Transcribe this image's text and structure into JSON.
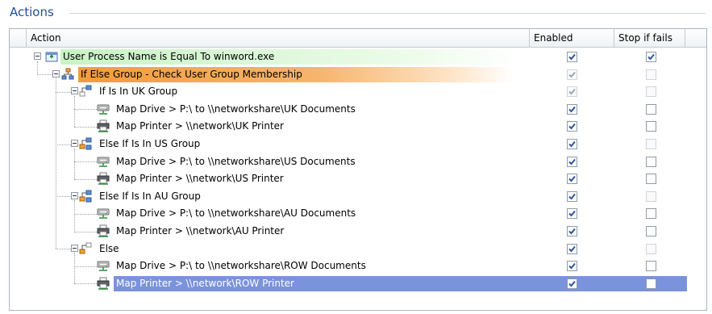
{
  "section": {
    "title": "Actions"
  },
  "columns": {
    "action": "Action",
    "enabled": "Enabled",
    "stop": "Stop if fails"
  },
  "rows": [
    {
      "label": "User Process Name is Equal To winword.exe",
      "level": 0,
      "icon": "process-condition-icon",
      "style": "green",
      "expanded": true,
      "enabled": true,
      "enabled_disabled": false,
      "stop": true,
      "stop_disabled": false
    },
    {
      "label": "If Else Group - Check User Group Membership",
      "level": 1,
      "icon": "if-else-group-icon",
      "style": "orange",
      "expanded": true,
      "enabled": true,
      "enabled_disabled": true,
      "stop": false,
      "stop_disabled": true
    },
    {
      "label": "If Is In UK Group",
      "level": 2,
      "icon": "if-branch-icon",
      "style": "",
      "expanded": true,
      "enabled": true,
      "enabled_disabled": true,
      "stop": false,
      "stop_disabled": true
    },
    {
      "label": "Map Drive > P:\\ to \\\\networkshare\\UK Documents",
      "level": 3,
      "icon": "map-drive-icon",
      "style": "",
      "enabled": true,
      "enabled_disabled": false,
      "stop": false,
      "stop_disabled": false
    },
    {
      "label": "Map Printer > \\\\network\\UK Printer",
      "level": 3,
      "icon": "printer-icon",
      "style": "",
      "enabled": true,
      "enabled_disabled": false,
      "stop": false,
      "stop_disabled": false
    },
    {
      "label": "Else If Is In US Group",
      "level": 2,
      "icon": "else-if-branch-icon",
      "style": "",
      "expanded": true,
      "enabled": true,
      "enabled_disabled": false,
      "stop": false,
      "stop_disabled": true
    },
    {
      "label": "Map Drive > P:\\ to \\\\networkshare\\US Documents",
      "level": 3,
      "icon": "map-drive-icon",
      "style": "",
      "enabled": true,
      "enabled_disabled": false,
      "stop": false,
      "stop_disabled": false
    },
    {
      "label": "Map Printer > \\\\network\\US Printer",
      "level": 3,
      "icon": "printer-icon",
      "style": "",
      "enabled": true,
      "enabled_disabled": false,
      "stop": false,
      "stop_disabled": false
    },
    {
      "label": "Else If Is In AU Group",
      "level": 2,
      "icon": "else-if-branch-icon",
      "style": "",
      "expanded": true,
      "enabled": true,
      "enabled_disabled": false,
      "stop": false,
      "stop_disabled": true
    },
    {
      "label": "Map Drive > P:\\ to \\\\networkshare\\AU Documents",
      "level": 3,
      "icon": "map-drive-icon",
      "style": "",
      "enabled": true,
      "enabled_disabled": false,
      "stop": false,
      "stop_disabled": false
    },
    {
      "label": "Map Printer > \\\\network\\AU Printer",
      "level": 3,
      "icon": "printer-icon",
      "style": "",
      "enabled": true,
      "enabled_disabled": false,
      "stop": false,
      "stop_disabled": false
    },
    {
      "label": "Else",
      "level": 2,
      "icon": "else-branch-icon",
      "style": "",
      "expanded": true,
      "enabled": true,
      "enabled_disabled": false,
      "stop": false,
      "stop_disabled": true
    },
    {
      "label": "Map Drive > P:\\ to \\\\networkshare\\ROW Documents",
      "level": 3,
      "icon": "map-drive-icon",
      "style": "",
      "enabled": true,
      "enabled_disabled": false,
      "stop": false,
      "stop_disabled": false
    },
    {
      "label": "Map Printer > \\\\network\\ROW Printer",
      "level": 3,
      "icon": "printer-icon",
      "style": "",
      "selected": true,
      "enabled": true,
      "enabled_disabled": false,
      "stop": false,
      "stop_disabled": false
    }
  ]
}
